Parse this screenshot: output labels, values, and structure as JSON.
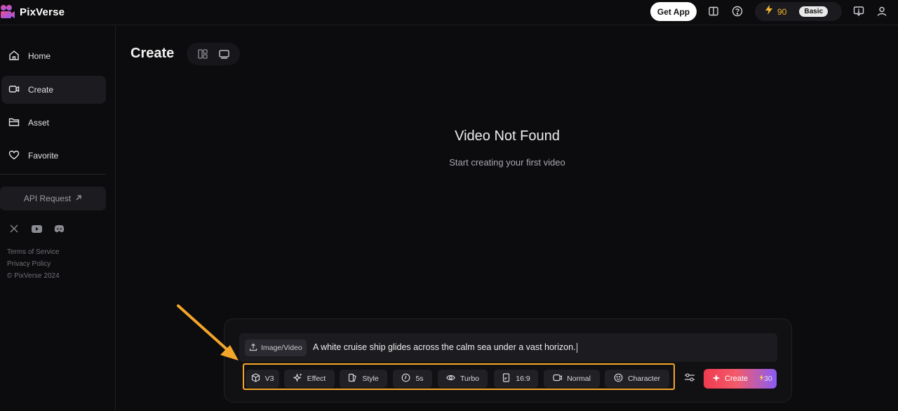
{
  "app": {
    "name": "PixVerse"
  },
  "topbar": {
    "get_app_label": "Get App",
    "credits": "90",
    "plan_badge": "Basic",
    "icons": [
      "book-icon",
      "help-icon",
      "lightning-icon",
      "feedback-icon",
      "user-icon"
    ]
  },
  "sidebar": {
    "items": [
      {
        "label": "Home",
        "icon": "home-icon"
      },
      {
        "label": "Create",
        "icon": "video-camera-icon",
        "active": true
      },
      {
        "label": "Asset",
        "icon": "folder-icon"
      },
      {
        "label": "Favorite",
        "icon": "heart-icon"
      }
    ],
    "api_label": "API Request",
    "socials": [
      "x-icon",
      "youtube-icon",
      "discord-icon"
    ],
    "legal": {
      "terms": "Terms of Service",
      "privacy": "Privacy Policy",
      "copyright": "© PixVerse 2024"
    }
  },
  "main": {
    "title": "Create",
    "empty_title": "Video Not Found",
    "empty_subtitle": "Start creating your first video"
  },
  "prompt": {
    "upload_label": "Image/Video",
    "text": "A white cruise ship glides across the calm sea under a vast horizon.",
    "options": [
      {
        "label": "V3",
        "icon": "cube-icon"
      },
      {
        "label": "Effect",
        "icon": "sparkle-icon"
      },
      {
        "label": "Style",
        "icon": "style-icon"
      },
      {
        "label": "5s",
        "icon": "clock-icon"
      },
      {
        "label": "Turbo",
        "icon": "eye-icon"
      },
      {
        "label": "16:9",
        "icon": "aspect-ratio-icon"
      },
      {
        "label": "Normal",
        "icon": "motion-icon"
      },
      {
        "label": "Character",
        "icon": "smiley-icon"
      }
    ],
    "create_label": "Create",
    "create_cost": "30"
  },
  "colors": {
    "accent_orange": "#f4a62a",
    "create_gradient_start": "#ef3b4f",
    "create_gradient_end": "#8a5cf6",
    "credit_color": "#f5b82e"
  }
}
